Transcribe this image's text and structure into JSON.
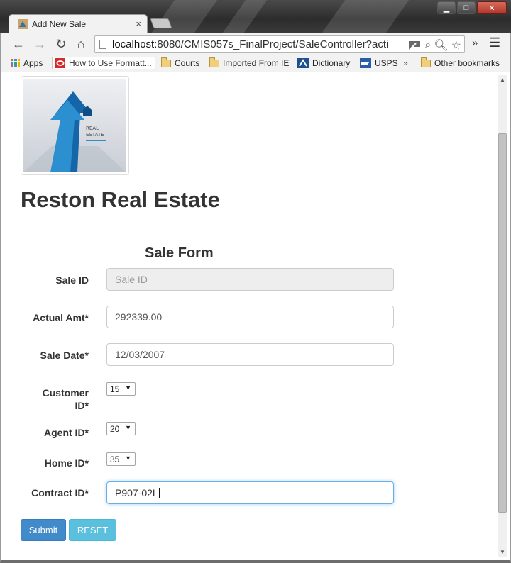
{
  "browser": {
    "tab_title": "Add New Sale",
    "tab_close": "×",
    "url_host": "localhost",
    "url_rest": ":8080/CMIS057s_FinalProject/SaleController?acti",
    "window_controls": {
      "minimize": "▁",
      "maximize": "□",
      "close": "✕"
    },
    "more_label": "»",
    "bookmarks": [
      {
        "label": "Apps",
        "icon": "apps-grid-icon"
      },
      {
        "label": "How to Use Formatt...",
        "icon": "oracle-icon"
      },
      {
        "label": "Courts",
        "icon": "folder-icon"
      },
      {
        "label": "Imported From IE",
        "icon": "folder-icon"
      },
      {
        "label": "Dictionary",
        "icon": "dictionary-icon"
      },
      {
        "label": "USPS",
        "icon": "usps-icon"
      },
      {
        "label": "»",
        "icon": ""
      },
      {
        "label": "Other bookmarks",
        "icon": "folder-icon"
      }
    ]
  },
  "page": {
    "logo_text_line1": "REAL",
    "logo_text_line2": "ESTATE",
    "site_title": "Reston Real Estate",
    "form_title": "Sale Form",
    "fields": {
      "sale_id": {
        "label": "Sale ID",
        "value": "",
        "placeholder": "Sale ID"
      },
      "actual_amt": {
        "label": "Actual Amt*",
        "value": "292339.00"
      },
      "sale_date": {
        "label": "Sale Date*",
        "value": "12/03/2007"
      },
      "customer_id": {
        "label_line1": "Customer",
        "label_line2": "ID*",
        "value": "15"
      },
      "agent_id": {
        "label": "Agent ID*",
        "value": "20"
      },
      "home_id": {
        "label": "Home ID*",
        "value": "35"
      },
      "contract_id": {
        "label": "Contract ID*",
        "value": "P907-02L"
      }
    },
    "buttons": {
      "submit": "Submit",
      "reset": "RESET"
    }
  },
  "colors": {
    "primary_button": "#428bca",
    "info_button": "#5bc0de",
    "logo_blue": "#1e6fb0"
  }
}
